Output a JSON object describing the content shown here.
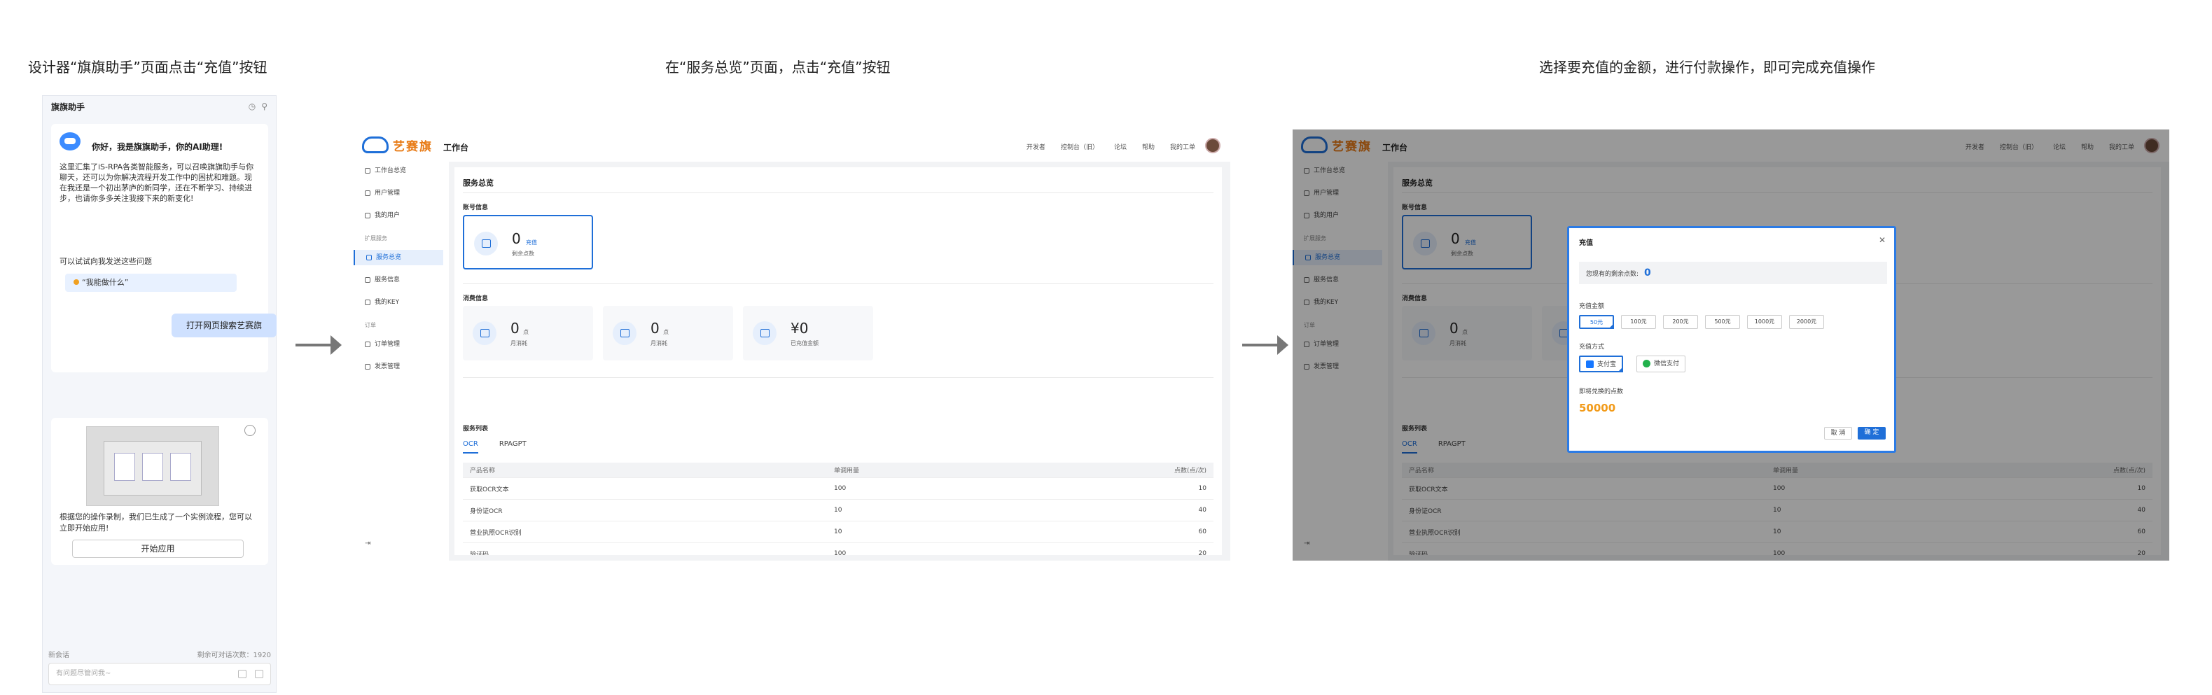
{
  "captions": {
    "step1": "设计器“旗旗助手”页面点击“充值”按钮",
    "step2": "在“服务总览”页面，点击“充值”按钮",
    "step3": "选择要充值的金额，进行付款操作，即可完成充值操作"
  },
  "assistant": {
    "title": "旗旗助手",
    "greeting": "你好，我是旗旗助手，你的AI助理!",
    "intro": "这里汇集了iS-RPA各类智能服务，可以召唤旗旗助手与你聊天，还可以为你解决流程开发工作中的困扰和难题。现在我还是一个初出茅庐的新同学，还在不断学习、持续进步，也请你多多关注我接下来的新变化!",
    "suggest_prompt": "可以试试向我发送这些问题",
    "suggestion": "“我能做什么”",
    "user_message": "打开网页搜索艺赛旗",
    "result_text": "根据您的操作录制，我们已生成了一个实例流程，您可以立即开始应用!",
    "start_button": "开始应用",
    "new_session": "新会话",
    "remaining": "剩余可对话次数：1920",
    "input_placeholder": "有问题尽管问我~"
  },
  "app": {
    "logo_text": "艺赛旗",
    "workspace": "工作台",
    "top_links": [
      "开发者",
      "控制台（旧）",
      "论坛",
      "帮助",
      "我的工单"
    ],
    "sidebar": {
      "items_top": [
        "工作台总览",
        "用户管理",
        "我的用户"
      ],
      "group_expand": "扩展服务",
      "items_mid": [
        "服务总览",
        "服务信息",
        "我的KEY"
      ],
      "group_order": "订单",
      "items_bottom": [
        "订单管理",
        "发票管理"
      ]
    },
    "page_title": "服务总览",
    "account_section": "账号信息",
    "balance_value": "0",
    "recharge_link": "充值",
    "balance_label": "剩余点数",
    "consume_section": "消费信息",
    "consume": [
      {
        "value": "0",
        "unit": "点",
        "label": "月消耗"
      },
      {
        "value": "0",
        "unit": "点",
        "label": "月消耗"
      },
      {
        "value": "¥0",
        "unit": "",
        "label": "已充值金额"
      }
    ],
    "service_section": "服务列表",
    "tabs": [
      "OCR",
      "RPAGPT"
    ],
    "table": {
      "headers": [
        "产品名称",
        "单调用量",
        "点数(点/次)"
      ],
      "rows": [
        [
          "获取OCR文本",
          "100",
          "10"
        ],
        [
          "身份证OCR",
          "10",
          "40"
        ],
        [
          "营业执照OCR识别",
          "10",
          "60"
        ],
        [
          "验证码",
          "100",
          "20"
        ]
      ]
    }
  },
  "modal": {
    "title": "充值",
    "balance_label": "您现有的剩余点数:",
    "balance_value": "0",
    "amount_label": "充值金额",
    "amounts": [
      "50元",
      "100元",
      "200元",
      "500元",
      "1000元",
      "2000元"
    ],
    "pay_label": "充值方式",
    "pay_methods": [
      "支付宝",
      "微信支付"
    ],
    "points_label": "即将兑换的点数",
    "points_value": "50000",
    "cancel": "取 消",
    "confirm": "确 定"
  },
  "colors": {
    "accent": "#1f6fd8",
    "logo_orange": "#e87b16",
    "points_orange": "#f29b1a"
  }
}
